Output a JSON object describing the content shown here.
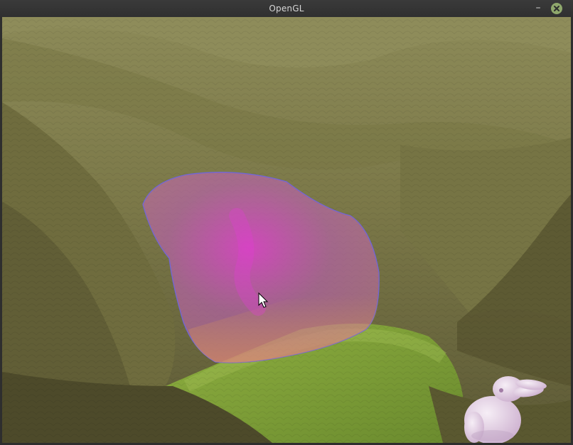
{
  "window": {
    "title": "OpenGL",
    "minimize_glyph": "–",
    "close_icon": "close-icon"
  },
  "scene": {
    "terrain_color": "#7e7c4a",
    "grass_color": "#7fa038",
    "bubble_color": "#d45ad0",
    "bunny_color": "#e6cde6",
    "cursor_icon": "arrow-pointer-icon"
  }
}
